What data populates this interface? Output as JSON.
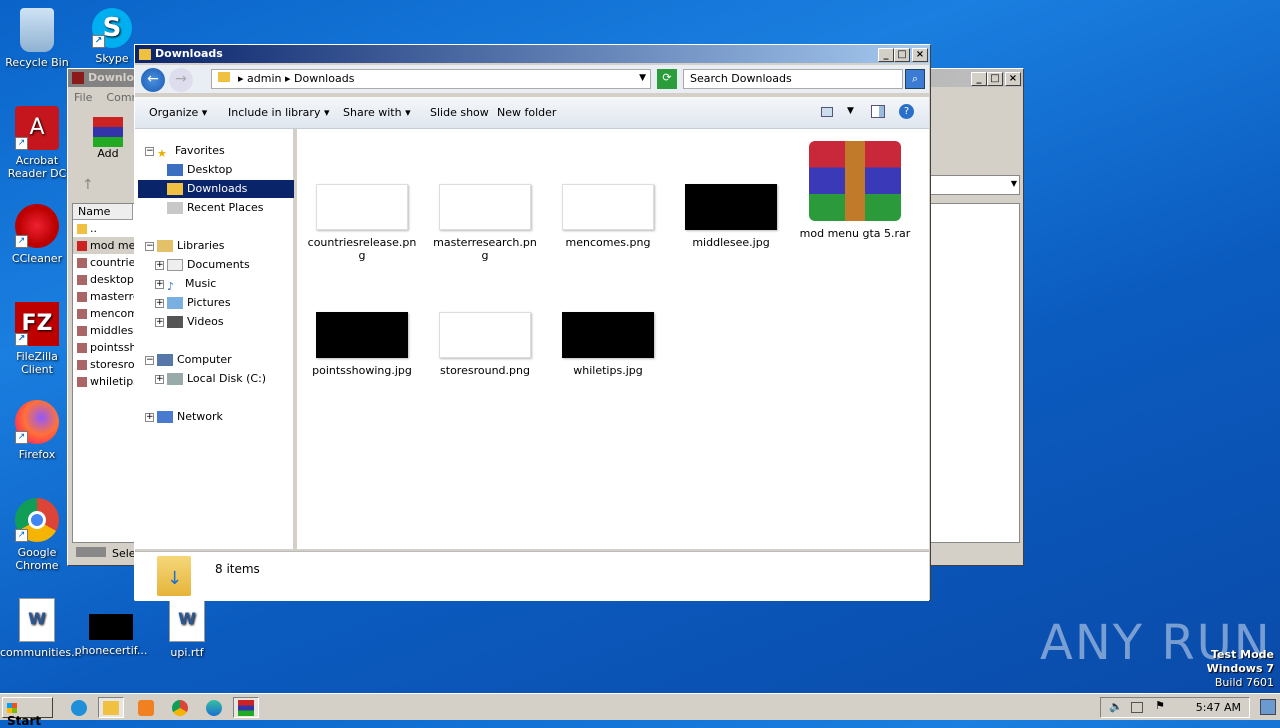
{
  "desktop": {
    "icons": [
      {
        "label": "Recycle Bin"
      },
      {
        "label": "Skype"
      },
      {
        "label": "Acrobat Reader DC"
      },
      {
        "label": "CCleaner"
      },
      {
        "label": "FileZilla Client"
      },
      {
        "label": "Firefox"
      },
      {
        "label": "Google Chrome"
      },
      {
        "label": "communities..."
      },
      {
        "label": "phonecertif..."
      },
      {
        "label": "upi.rtf"
      }
    ],
    "watermark": "ANY RUN",
    "testmode": {
      "line1": "Test Mode",
      "line2": "Windows 7",
      "line3": "Build 7601"
    }
  },
  "back_window": {
    "title": "Downlo",
    "menu": [
      "File",
      "Comm"
    ],
    "add_label": "Add",
    "column_name": "Name",
    "files": [
      "..",
      "mod men",
      "countrie",
      "desktop",
      "masterre",
      "mencom",
      "middlese",
      "pointssh",
      "storesro",
      "whiletips"
    ],
    "status": "Sele"
  },
  "explorer": {
    "title": "Downloads",
    "breadcrumb": {
      "part1": "admin",
      "part2": "Downloads"
    },
    "search_placeholder": "Search Downloads",
    "commands": {
      "organize": "Organize",
      "include": "Include in library",
      "share": "Share with",
      "slideshow": "Slide show",
      "newfolder": "New folder"
    },
    "nav": {
      "favorites": "Favorites",
      "desktop": "Desktop",
      "downloads": "Downloads",
      "recent": "Recent Places",
      "libraries": "Libraries",
      "documents": "Documents",
      "music": "Music",
      "pictures": "Pictures",
      "videos": "Videos",
      "computer": "Computer",
      "localdisk": "Local Disk (C:)",
      "network": "Network"
    },
    "files": [
      {
        "name": "countriesrelease.png"
      },
      {
        "name": "masterresearch.png"
      },
      {
        "name": "mencomes.png"
      },
      {
        "name": "middlesee.jpg"
      },
      {
        "name": "mod menu gta 5.rar"
      },
      {
        "name": "pointsshowing.jpg"
      },
      {
        "name": "storesround.png"
      },
      {
        "name": "whiletips.jpg"
      }
    ],
    "item_count": "8 items"
  },
  "taskbar": {
    "start": "Start",
    "clock": "5:47 AM"
  }
}
